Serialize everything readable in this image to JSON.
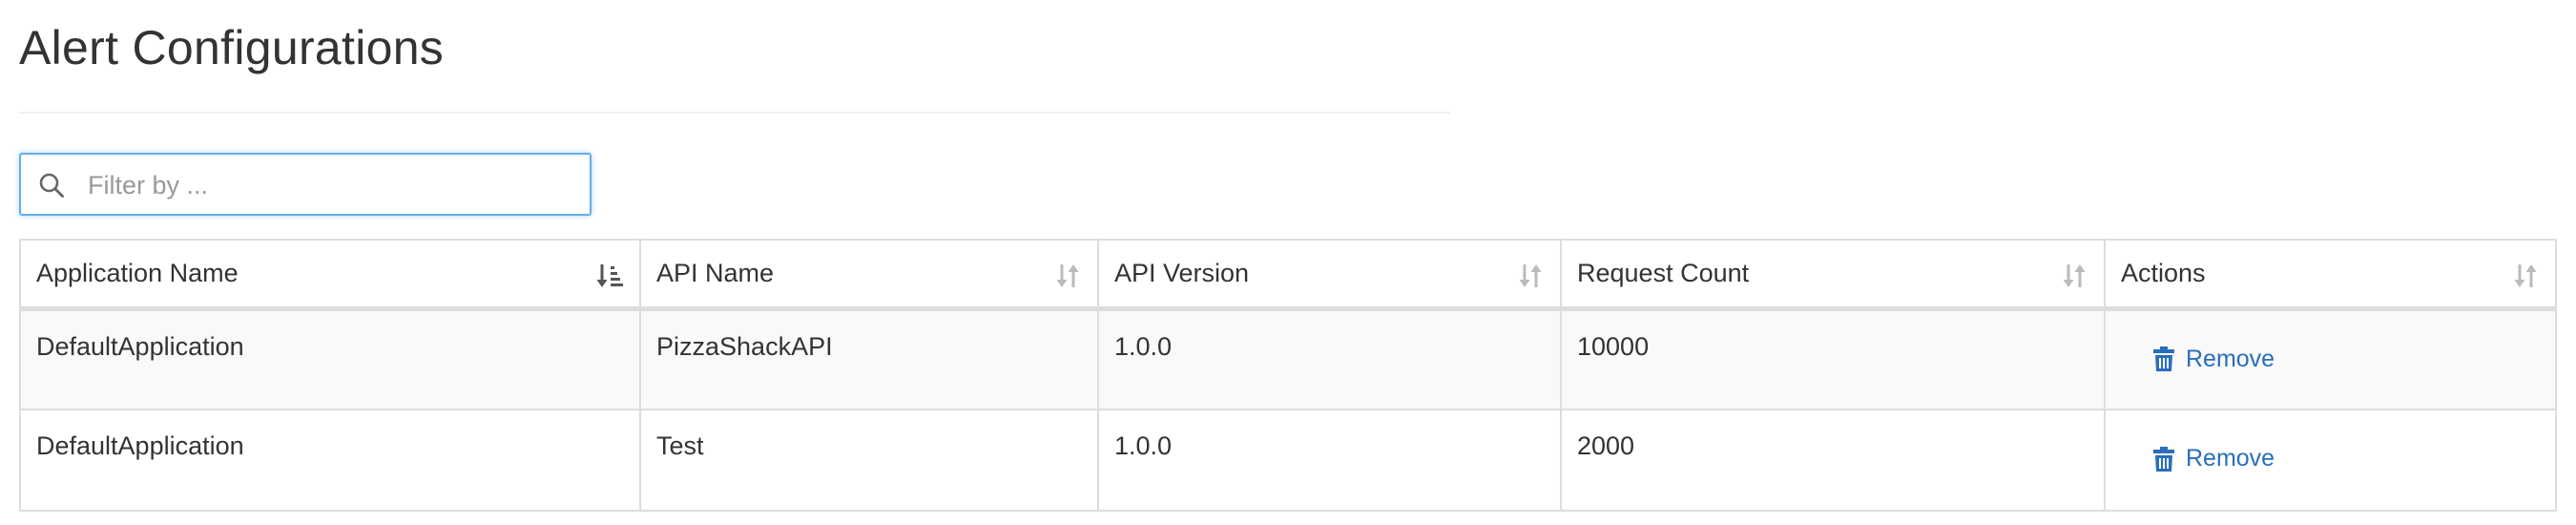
{
  "page": {
    "title": "Alert Configurations"
  },
  "search": {
    "placeholder": "Filter by ...",
    "value": "",
    "icon": "search-icon"
  },
  "table": {
    "columns": [
      {
        "label": "Application Name",
        "sort_icon": "sort-alpha-down-icon",
        "sorted": true
      },
      {
        "label": "API Name",
        "sort_icon": "sort-icon",
        "sorted": false
      },
      {
        "label": "API Version",
        "sort_icon": "sort-icon",
        "sorted": false
      },
      {
        "label": "Request Count",
        "sort_icon": "sort-icon",
        "sorted": false
      },
      {
        "label": "Actions",
        "sort_icon": "sort-icon",
        "sorted": false
      }
    ],
    "rows": [
      {
        "application_name": "DefaultApplication",
        "api_name": "PizzaShackAPI",
        "api_version": "1.0.0",
        "request_count": "10000",
        "action_label": "Remove"
      },
      {
        "application_name": "DefaultApplication",
        "api_name": "Test",
        "api_version": "1.0.0",
        "request_count": "2000",
        "action_label": "Remove"
      }
    ]
  },
  "colors": {
    "accent": "#2a6ebb",
    "focus_border": "#66afe9",
    "border": "#dddddd",
    "stripe": "#f9f9f9",
    "icon_gray": "#999999"
  }
}
